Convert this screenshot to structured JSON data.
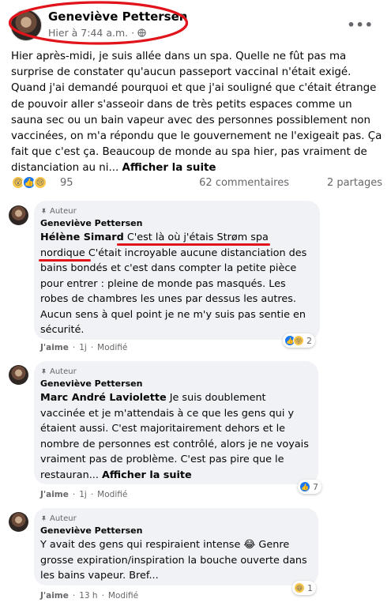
{
  "post": {
    "author": "Geneviève Pettersen",
    "timestamp": "Hier à 7:44 a.m.",
    "separator": "·",
    "text": "Hier après-midi, je suis allée dans un spa. Quelle ne fût pas ma surprise de constater qu'aucun passeport vaccinal n'était exigé. Quand j'ai demandé pourquoi et que j'ai souligné que c'était étrange de pouvoir aller s'asseoir dans de très petits espaces comme un sauna sec ou un bain vapeur avec des personnes possiblement non vaccinées, on m'a répondu que le gouvernement ne l'exigeait pas. Ça fait que c'est ça. Beaucoup de monde au spa hier, pas vraiment de distanciation au ni...",
    "see_more": "Afficher la suite",
    "reaction_count": "95",
    "comments_count": "62 commentaires",
    "shares_count": "2 partages"
  },
  "comments": [
    {
      "author_tag": "Auteur",
      "name": "Geneviève Pettersen",
      "mention": "Hélène Simard",
      "text": " C'est là où j'étais Strøm spa nordique C'était incroyable aucune distanciation des bains bondés et c'est dans compter la petite pièce pour entrer : pleine de monde pas masqués. Les robes de chambres les unes par dessus les autres. Aucun sens à quel point je ne m'y suis pas sentie en sécurité.",
      "like": "J'aime",
      "time": "1j",
      "edited": "Modifié",
      "reaction_count": "2"
    },
    {
      "author_tag": "Auteur",
      "name": "Geneviève Pettersen",
      "mention": "Marc André Laviolette",
      "text": " Je suis doublement vaccinée et je m'attendais à ce que les gens qui y étaient aussi. C'est majoritairement dehors et le nombre de personnes est contrôlé, alors je ne voyais vraiment pas de problème. C'est pas pire que le restauran...",
      "see_more": "Afficher la suite",
      "like": "J'aime",
      "time": "1j",
      "edited": "Modifié",
      "reaction_count": "7"
    },
    {
      "author_tag": "Auteur",
      "name": "Geneviève Pettersen",
      "text": "Y avait des gens qui respiraient intense 😂 Genre grosse expiration/inspiration la bouche ouverte dans les bains vapeur. Bref...",
      "like": "J'aime",
      "time": "13 h",
      "edited": "Modifié",
      "reaction_count": "1"
    }
  ],
  "colors": {
    "annotation_red": "#e0141a",
    "like_blue": "#1877f2",
    "bubble_grey": "#f0f2f5",
    "meta_grey": "#65676b"
  },
  "icons": [
    "globe-icon",
    "more-icon",
    "pin-icon",
    "wow-reaction-icon",
    "like-reaction-icon",
    "sad-reaction-icon",
    "haha-reaction-icon"
  ]
}
